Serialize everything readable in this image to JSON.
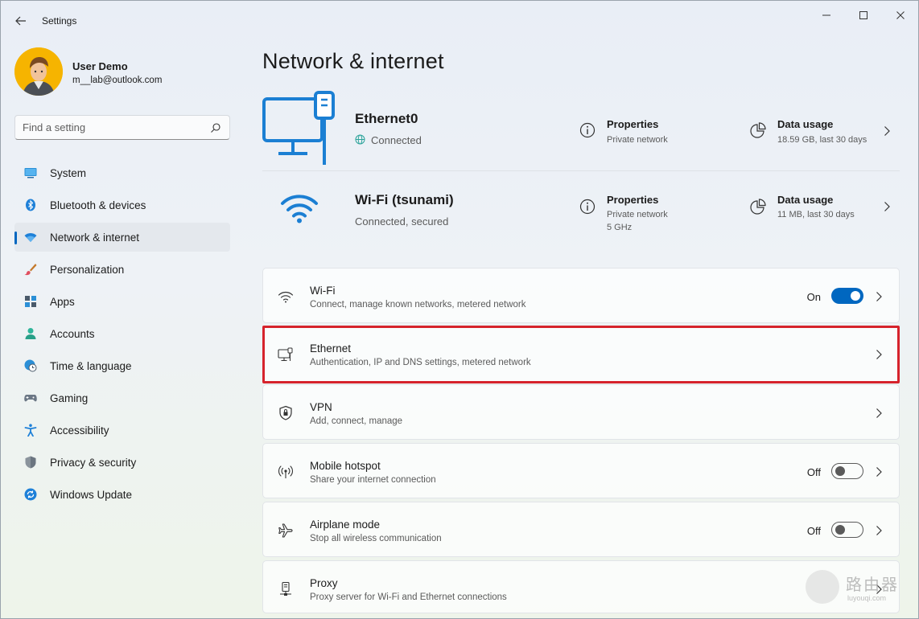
{
  "window": {
    "title": "Settings"
  },
  "profile": {
    "name": "User Demo",
    "email": "m__lab@outlook.com"
  },
  "search": {
    "placeholder": "Find a setting"
  },
  "sidebar": {
    "items": [
      {
        "label": "System",
        "icon": "monitor-icon"
      },
      {
        "label": "Bluetooth & devices",
        "icon": "bluetooth-icon"
      },
      {
        "label": "Network & internet",
        "icon": "wifi-icon",
        "active": true
      },
      {
        "label": "Personalization",
        "icon": "brush-icon"
      },
      {
        "label": "Apps",
        "icon": "apps-icon"
      },
      {
        "label": "Accounts",
        "icon": "person-icon"
      },
      {
        "label": "Time & language",
        "icon": "globe-clock-icon"
      },
      {
        "label": "Gaming",
        "icon": "gamepad-icon"
      },
      {
        "label": "Accessibility",
        "icon": "accessibility-icon"
      },
      {
        "label": "Privacy & security",
        "icon": "shield-icon"
      },
      {
        "label": "Windows Update",
        "icon": "update-icon"
      }
    ]
  },
  "page": {
    "title": "Network & internet"
  },
  "connections": {
    "ethernet": {
      "name": "Ethernet0",
      "status": "Connected",
      "properties_title": "Properties",
      "properties_sub": "Private network",
      "usage_title": "Data usage",
      "usage_sub": "18.59 GB, last 30 days"
    },
    "wifi": {
      "name": "Wi-Fi (tsunami)",
      "status": "Connected, secured",
      "properties_title": "Properties",
      "properties_sub": "Private network",
      "properties_sub2": "5 GHz",
      "usage_title": "Data usage",
      "usage_sub": "11 MB, last 30 days"
    }
  },
  "cards": {
    "wifi": {
      "title": "Wi-Fi",
      "sub": "Connect, manage known networks, metered network",
      "toggle": "On"
    },
    "ethernet": {
      "title": "Ethernet",
      "sub": "Authentication, IP and DNS settings, metered network"
    },
    "vpn": {
      "title": "VPN",
      "sub": "Add, connect, manage"
    },
    "hotspot": {
      "title": "Mobile hotspot",
      "sub": "Share your internet connection",
      "toggle": "Off"
    },
    "airplane": {
      "title": "Airplane mode",
      "sub": "Stop all wireless communication",
      "toggle": "Off"
    },
    "proxy": {
      "title": "Proxy",
      "sub": "Proxy server for Wi-Fi and Ethernet connections"
    }
  },
  "watermark": {
    "text": "路由器",
    "url": "luyouqi.com"
  },
  "colors": {
    "accent": "#0067c0",
    "highlight": "#d6232c"
  }
}
